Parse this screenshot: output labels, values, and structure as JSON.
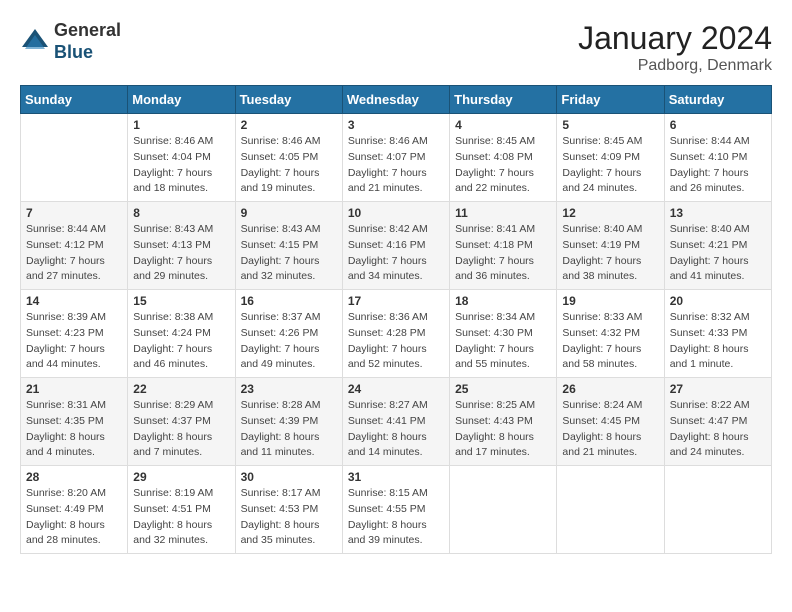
{
  "header": {
    "logo_general": "General",
    "logo_blue": "Blue",
    "title": "January 2024",
    "subtitle": "Padborg, Denmark"
  },
  "days_of_week": [
    "Sunday",
    "Monday",
    "Tuesday",
    "Wednesday",
    "Thursday",
    "Friday",
    "Saturday"
  ],
  "weeks": [
    [
      {
        "day": "",
        "info": ""
      },
      {
        "day": "1",
        "info": "Sunrise: 8:46 AM\nSunset: 4:04 PM\nDaylight: 7 hours\nand 18 minutes."
      },
      {
        "day": "2",
        "info": "Sunrise: 8:46 AM\nSunset: 4:05 PM\nDaylight: 7 hours\nand 19 minutes."
      },
      {
        "day": "3",
        "info": "Sunrise: 8:46 AM\nSunset: 4:07 PM\nDaylight: 7 hours\nand 21 minutes."
      },
      {
        "day": "4",
        "info": "Sunrise: 8:45 AM\nSunset: 4:08 PM\nDaylight: 7 hours\nand 22 minutes."
      },
      {
        "day": "5",
        "info": "Sunrise: 8:45 AM\nSunset: 4:09 PM\nDaylight: 7 hours\nand 24 minutes."
      },
      {
        "day": "6",
        "info": "Sunrise: 8:44 AM\nSunset: 4:10 PM\nDaylight: 7 hours\nand 26 minutes."
      }
    ],
    [
      {
        "day": "7",
        "info": "Sunrise: 8:44 AM\nSunset: 4:12 PM\nDaylight: 7 hours\nand 27 minutes."
      },
      {
        "day": "8",
        "info": "Sunrise: 8:43 AM\nSunset: 4:13 PM\nDaylight: 7 hours\nand 29 minutes."
      },
      {
        "day": "9",
        "info": "Sunrise: 8:43 AM\nSunset: 4:15 PM\nDaylight: 7 hours\nand 32 minutes."
      },
      {
        "day": "10",
        "info": "Sunrise: 8:42 AM\nSunset: 4:16 PM\nDaylight: 7 hours\nand 34 minutes."
      },
      {
        "day": "11",
        "info": "Sunrise: 8:41 AM\nSunset: 4:18 PM\nDaylight: 7 hours\nand 36 minutes."
      },
      {
        "day": "12",
        "info": "Sunrise: 8:40 AM\nSunset: 4:19 PM\nDaylight: 7 hours\nand 38 minutes."
      },
      {
        "day": "13",
        "info": "Sunrise: 8:40 AM\nSunset: 4:21 PM\nDaylight: 7 hours\nand 41 minutes."
      }
    ],
    [
      {
        "day": "14",
        "info": "Sunrise: 8:39 AM\nSunset: 4:23 PM\nDaylight: 7 hours\nand 44 minutes."
      },
      {
        "day": "15",
        "info": "Sunrise: 8:38 AM\nSunset: 4:24 PM\nDaylight: 7 hours\nand 46 minutes."
      },
      {
        "day": "16",
        "info": "Sunrise: 8:37 AM\nSunset: 4:26 PM\nDaylight: 7 hours\nand 49 minutes."
      },
      {
        "day": "17",
        "info": "Sunrise: 8:36 AM\nSunset: 4:28 PM\nDaylight: 7 hours\nand 52 minutes."
      },
      {
        "day": "18",
        "info": "Sunrise: 8:34 AM\nSunset: 4:30 PM\nDaylight: 7 hours\nand 55 minutes."
      },
      {
        "day": "19",
        "info": "Sunrise: 8:33 AM\nSunset: 4:32 PM\nDaylight: 7 hours\nand 58 minutes."
      },
      {
        "day": "20",
        "info": "Sunrise: 8:32 AM\nSunset: 4:33 PM\nDaylight: 8 hours\nand 1 minute."
      }
    ],
    [
      {
        "day": "21",
        "info": "Sunrise: 8:31 AM\nSunset: 4:35 PM\nDaylight: 8 hours\nand 4 minutes."
      },
      {
        "day": "22",
        "info": "Sunrise: 8:29 AM\nSunset: 4:37 PM\nDaylight: 8 hours\nand 7 minutes."
      },
      {
        "day": "23",
        "info": "Sunrise: 8:28 AM\nSunset: 4:39 PM\nDaylight: 8 hours\nand 11 minutes."
      },
      {
        "day": "24",
        "info": "Sunrise: 8:27 AM\nSunset: 4:41 PM\nDaylight: 8 hours\nand 14 minutes."
      },
      {
        "day": "25",
        "info": "Sunrise: 8:25 AM\nSunset: 4:43 PM\nDaylight: 8 hours\nand 17 minutes."
      },
      {
        "day": "26",
        "info": "Sunrise: 8:24 AM\nSunset: 4:45 PM\nDaylight: 8 hours\nand 21 minutes."
      },
      {
        "day": "27",
        "info": "Sunrise: 8:22 AM\nSunset: 4:47 PM\nDaylight: 8 hours\nand 24 minutes."
      }
    ],
    [
      {
        "day": "28",
        "info": "Sunrise: 8:20 AM\nSunset: 4:49 PM\nDaylight: 8 hours\nand 28 minutes."
      },
      {
        "day": "29",
        "info": "Sunrise: 8:19 AM\nSunset: 4:51 PM\nDaylight: 8 hours\nand 32 minutes."
      },
      {
        "day": "30",
        "info": "Sunrise: 8:17 AM\nSunset: 4:53 PM\nDaylight: 8 hours\nand 35 minutes."
      },
      {
        "day": "31",
        "info": "Sunrise: 8:15 AM\nSunset: 4:55 PM\nDaylight: 8 hours\nand 39 minutes."
      },
      {
        "day": "",
        "info": ""
      },
      {
        "day": "",
        "info": ""
      },
      {
        "day": "",
        "info": ""
      }
    ]
  ]
}
